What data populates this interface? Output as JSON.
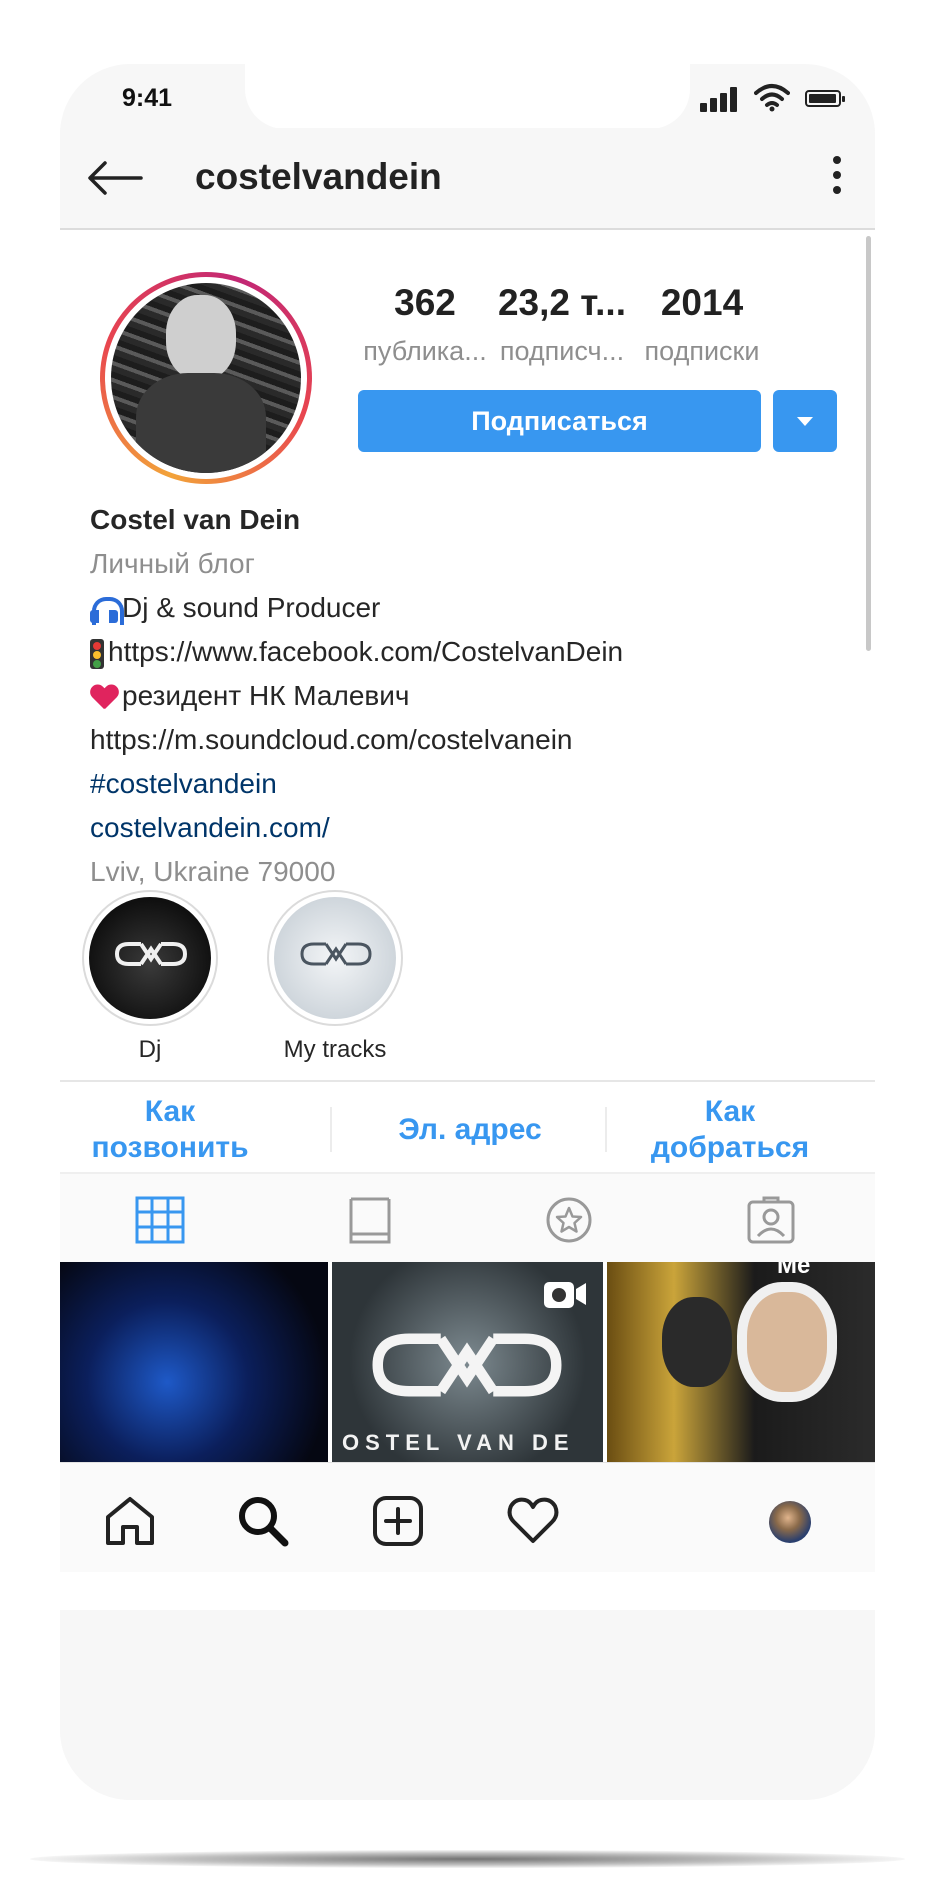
{
  "status_bar": {
    "time": "9:41"
  },
  "header": {
    "username": "costelvandein"
  },
  "profile": {
    "stats": [
      {
        "value": "362",
        "label": "публика..."
      },
      {
        "value": "23,2 т...",
        "label": "подписч..."
      },
      {
        "value": "2014",
        "label": "подписки"
      }
    ],
    "follow_label": "Подписаться",
    "bio": {
      "name": "Costel van Dein",
      "category": "Личный блог",
      "line1": "Dj & sound Producer",
      "line2": "https://www.facebook.com/CostelvanDein",
      "line3": "резидент НК Малевич",
      "line4": "https://m.soundcloud.com/costelvanein",
      "hashtag": "#costelvandein",
      "website": "costelvandein.com/",
      "location": "Lviv, Ukraine 79000"
    }
  },
  "highlights": [
    {
      "label": "Dj",
      "icon": "cvd-logo-dark"
    },
    {
      "label": "My tracks",
      "icon": "cvd-logo-light"
    }
  ],
  "contact_buttons": {
    "call": {
      "line1": "Как",
      "line2": "позвонить"
    },
    "email": "Эл. адрес",
    "directions": {
      "line1": "Как",
      "line2": "добраться"
    }
  },
  "profile_tabs": [
    "grid-icon",
    "igtv-icon",
    "guides-icon",
    "tagged-icon"
  ],
  "grid_posts": [
    {
      "icon": "none"
    },
    {
      "text": "OSTEL VAN DE",
      "icon": "video-camera-icon"
    },
    {
      "text": "Me",
      "icon": "none"
    }
  ],
  "bottom_nav": [
    "home-icon",
    "search-icon",
    "add-post-icon",
    "heart-icon",
    "profile-avatar"
  ],
  "colors": {
    "accent": "#3897f0",
    "link": "#003569",
    "text": "#262626",
    "muted": "#8e8e8e",
    "phone_frame": "#f7f7f7"
  }
}
